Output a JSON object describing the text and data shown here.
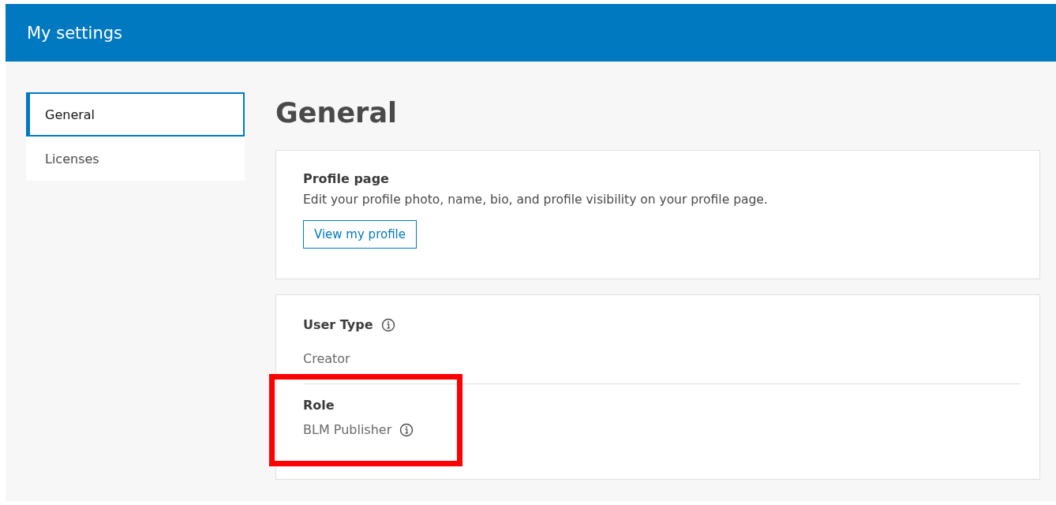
{
  "header": {
    "title": "My settings"
  },
  "sidebar": {
    "items": [
      {
        "label": "General",
        "selected": true
      },
      {
        "label": "Licenses",
        "selected": false
      }
    ]
  },
  "page_title": "General",
  "profile_card": {
    "heading": "Profile page",
    "description": "Edit your profile photo, name, bio, and profile visibility on your profile page.",
    "button": "View my profile"
  },
  "account_card": {
    "user_type": {
      "label": "User Type",
      "value": "Creator"
    },
    "role": {
      "label": "Role",
      "value": "BLM Publisher",
      "highlighted": true
    }
  }
}
